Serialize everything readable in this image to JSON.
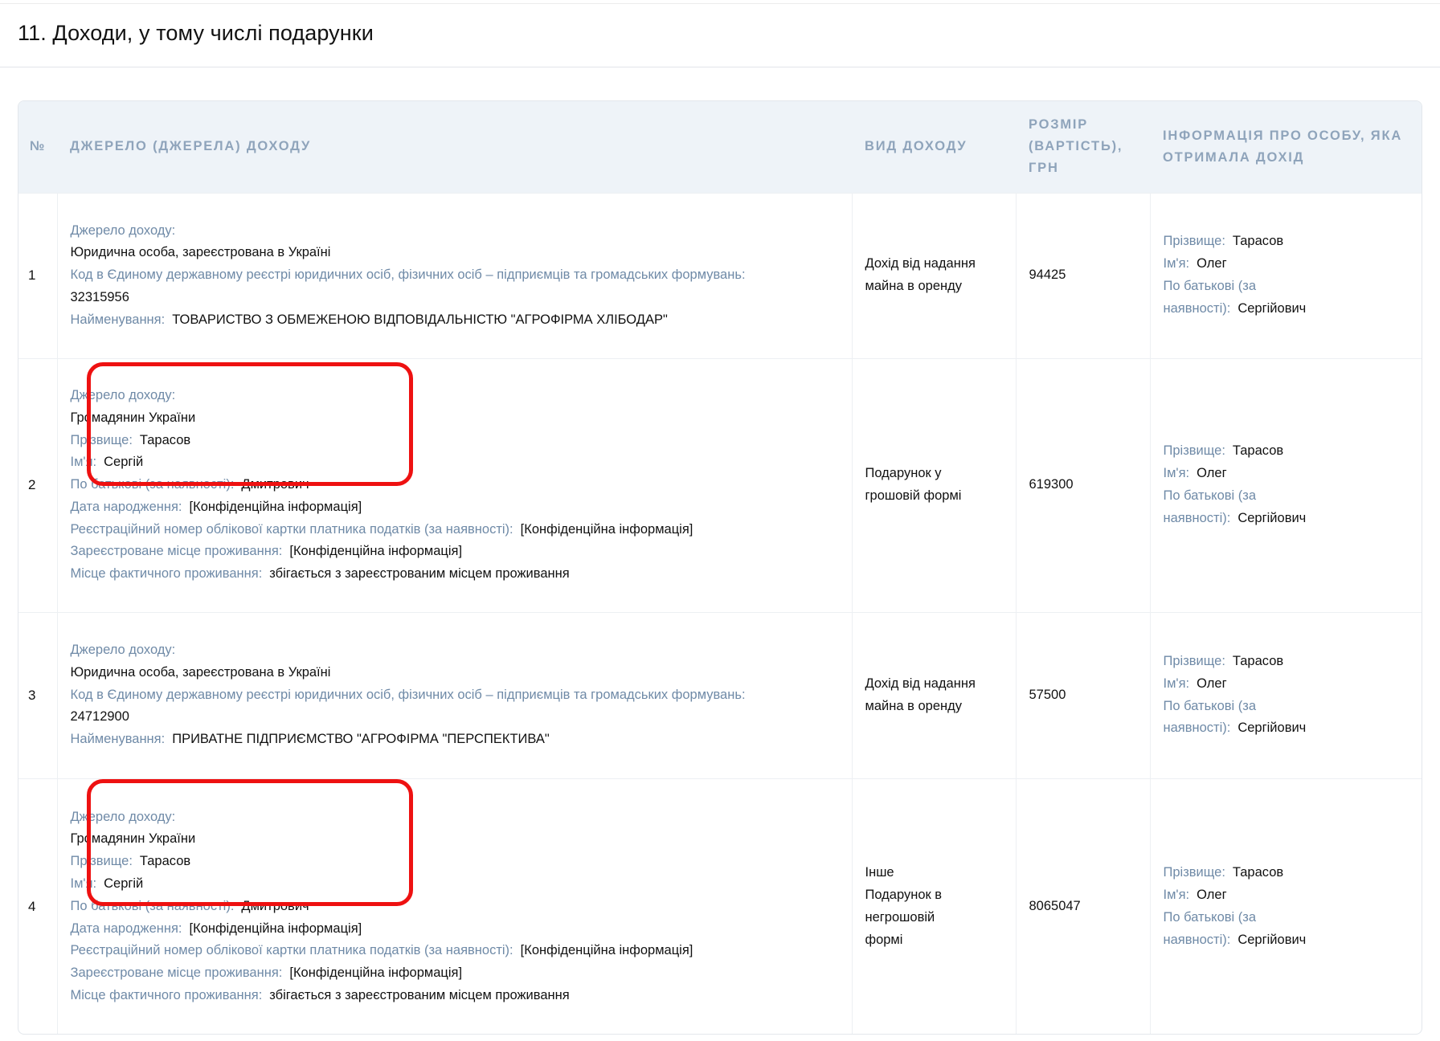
{
  "section_title": "11. Доходи, у тому числі подарунки",
  "table": {
    "headers": {
      "num": "№",
      "source": "Джерело (джерела) доходу",
      "kind": "Вид доходу",
      "amount_l1": "Розмір",
      "amount_l2": "(вартість),",
      "amount_l3": "грн",
      "person_l1": "Інформація про особу, яка",
      "person_l2": "отримала дохід"
    },
    "rows": [
      {
        "num": "1",
        "source_label": "Джерело доходу:",
        "source_type": "Юридична особа, зареєстрована в Україні",
        "code_label": "Код в Єдиному державному реєстрі юридичних осіб, фізичних осіб – підприємців та громадських формувань:",
        "code_value": "32315956",
        "name_label": "Найменування:",
        "name_value": "ТОВАРИСТВО З ОБМЕЖЕНОЮ ВІДПОВІДАЛЬНІСТЮ \"АГРОФІРМА ХЛІБОДАР\"",
        "kind_l1": "Дохід від надання",
        "kind_l2": "майна в оренду",
        "amount": "94425",
        "person": {
          "surname_label": "Прізвище:",
          "surname": "Тарасов",
          "first_label": "Ім'я:",
          "first": "Олег",
          "patr_label_l1": "По батькові (за",
          "patr_label_l2": "наявності):",
          "patr": "Сергійович"
        }
      },
      {
        "num": "2",
        "source_label": "Джерело доходу:",
        "source_type": "Громадянин України",
        "surname_label": "Прізвище:",
        "surname": "Тарасов",
        "first_label": "Ім'я:",
        "first": "Сергій",
        "patr_label": "По батькові (за наявності):",
        "patr": "Дмитрович",
        "dob_label": "Дата народження:",
        "dob": "[Конфіденційна інформація]",
        "tax_label": "Реєстраційний номер облікової картки платника податків (за наявності):",
        "tax": "[Конфіденційна інформація]",
        "reg_label": "Зареєстроване місце проживання:",
        "reg": "[Конфіденційна інформація]",
        "actual_label": "Місце фактичного проживання:",
        "actual": "збігається з зареєстрованим місцем проживання",
        "kind_l1": "Подарунок у",
        "kind_l2": "грошовій формі",
        "amount": "619300",
        "person": {
          "surname_label": "Прізвище:",
          "surname": "Тарасов",
          "first_label": "Ім'я:",
          "first": "Олег",
          "patr_label_l1": "По батькові (за",
          "patr_label_l2": "наявності):",
          "patr": "Сергійович"
        }
      },
      {
        "num": "3",
        "source_label": "Джерело доходу:",
        "source_type": "Юридична особа, зареєстрована в Україні",
        "code_label": "Код в Єдиному державному реєстрі юридичних осіб, фізичних осіб – підприємців та громадських формувань:",
        "code_value": "24712900",
        "name_label": "Найменування:",
        "name_value": "ПРИВАТНЕ ПІДПРИЄМСТВО \"АГРОФІРМА \"ПЕРСПЕКТИВА\"",
        "kind_l1": "Дохід від надання",
        "kind_l2": "майна в оренду",
        "amount": "57500",
        "person": {
          "surname_label": "Прізвище:",
          "surname": "Тарасов",
          "first_label": "Ім'я:",
          "first": "Олег",
          "patr_label_l1": "По батькові (за",
          "patr_label_l2": "наявності):",
          "patr": "Сергійович"
        }
      },
      {
        "num": "4",
        "source_label": "Джерело доходу:",
        "source_type": "Громадянин України",
        "surname_label": "Прізвище:",
        "surname": "Тарасов",
        "first_label": "Ім'я:",
        "first": "Сергій",
        "patr_label": "По батькові (за наявності):",
        "patr": "Дмитрович",
        "dob_label": "Дата народження:",
        "dob": "[Конфіденційна інформація]",
        "tax_label": "Реєстраційний номер облікової картки платника податків (за наявності):",
        "tax": "[Конфіденційна інформація]",
        "reg_label": "Зареєстроване місце проживання:",
        "reg": "[Конфіденційна інформація]",
        "actual_label": "Місце фактичного проживання:",
        "actual": "збігається з зареєстрованим місцем проживання",
        "kind_l1": "Інше",
        "kind_l2": "Подарунок в",
        "kind_l3": "негрошовій",
        "kind_l4": "формі",
        "amount": "8065047",
        "person": {
          "surname_label": "Прізвище:",
          "surname": "Тарасов",
          "first_label": "Ім'я:",
          "first": "Олег",
          "patr_label_l1": "По батькові (за",
          "patr_label_l2": "наявності):",
          "patr": "Сергійович"
        }
      }
    ]
  },
  "highlight_color": "#ee1111"
}
